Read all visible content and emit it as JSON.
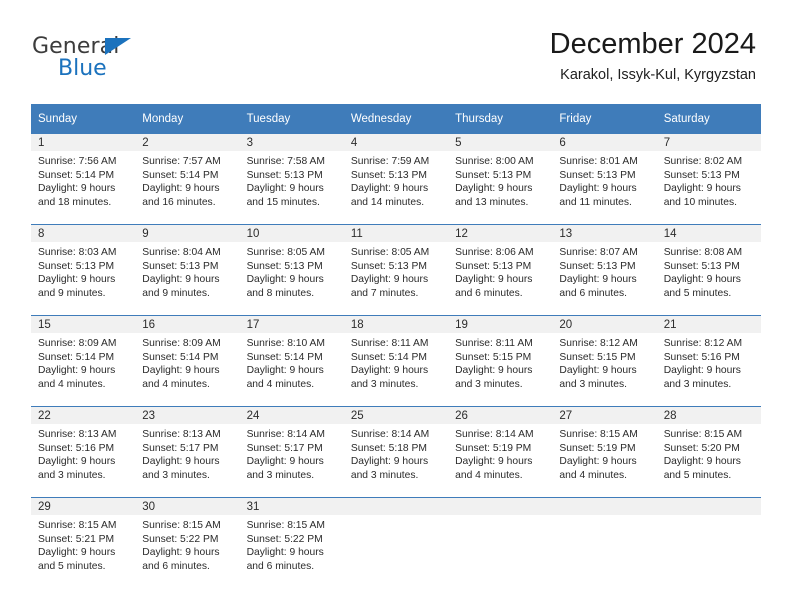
{
  "logo": {
    "text_general": "General",
    "text_blue": "Blue",
    "triangle_icon": "blue-triangle-icon",
    "color_blue": "#1b72bd",
    "color_general": "#3c3c3c"
  },
  "header": {
    "title": "December 2024",
    "subtitle": "Karakol, Issyk-Kul, Kyrgyzstan"
  },
  "theme": {
    "header_blue": "#3f7cba",
    "row_band_gray": "#f1f1f1",
    "text_dark": "#2b2b2b"
  },
  "calendar": {
    "weekday_headers": [
      "Sunday",
      "Monday",
      "Tuesday",
      "Wednesday",
      "Thursday",
      "Friday",
      "Saturday"
    ],
    "weeks": [
      [
        {
          "day": "1",
          "sunrise": "Sunrise: 7:56 AM",
          "sunset": "Sunset: 5:14 PM",
          "daylight_1": "Daylight: 9 hours",
          "daylight_2": "and 18 minutes."
        },
        {
          "day": "2",
          "sunrise": "Sunrise: 7:57 AM",
          "sunset": "Sunset: 5:14 PM",
          "daylight_1": "Daylight: 9 hours",
          "daylight_2": "and 16 minutes."
        },
        {
          "day": "3",
          "sunrise": "Sunrise: 7:58 AM",
          "sunset": "Sunset: 5:13 PM",
          "daylight_1": "Daylight: 9 hours",
          "daylight_2": "and 15 minutes."
        },
        {
          "day": "4",
          "sunrise": "Sunrise: 7:59 AM",
          "sunset": "Sunset: 5:13 PM",
          "daylight_1": "Daylight: 9 hours",
          "daylight_2": "and 14 minutes."
        },
        {
          "day": "5",
          "sunrise": "Sunrise: 8:00 AM",
          "sunset": "Sunset: 5:13 PM",
          "daylight_1": "Daylight: 9 hours",
          "daylight_2": "and 13 minutes."
        },
        {
          "day": "6",
          "sunrise": "Sunrise: 8:01 AM",
          "sunset": "Sunset: 5:13 PM",
          "daylight_1": "Daylight: 9 hours",
          "daylight_2": "and 11 minutes."
        },
        {
          "day": "7",
          "sunrise": "Sunrise: 8:02 AM",
          "sunset": "Sunset: 5:13 PM",
          "daylight_1": "Daylight: 9 hours",
          "daylight_2": "and 10 minutes."
        }
      ],
      [
        {
          "day": "8",
          "sunrise": "Sunrise: 8:03 AM",
          "sunset": "Sunset: 5:13 PM",
          "daylight_1": "Daylight: 9 hours",
          "daylight_2": "and 9 minutes."
        },
        {
          "day": "9",
          "sunrise": "Sunrise: 8:04 AM",
          "sunset": "Sunset: 5:13 PM",
          "daylight_1": "Daylight: 9 hours",
          "daylight_2": "and 9 minutes."
        },
        {
          "day": "10",
          "sunrise": "Sunrise: 8:05 AM",
          "sunset": "Sunset: 5:13 PM",
          "daylight_1": "Daylight: 9 hours",
          "daylight_2": "and 8 minutes."
        },
        {
          "day": "11",
          "sunrise": "Sunrise: 8:05 AM",
          "sunset": "Sunset: 5:13 PM",
          "daylight_1": "Daylight: 9 hours",
          "daylight_2": "and 7 minutes."
        },
        {
          "day": "12",
          "sunrise": "Sunrise: 8:06 AM",
          "sunset": "Sunset: 5:13 PM",
          "daylight_1": "Daylight: 9 hours",
          "daylight_2": "and 6 minutes."
        },
        {
          "day": "13",
          "sunrise": "Sunrise: 8:07 AM",
          "sunset": "Sunset: 5:13 PM",
          "daylight_1": "Daylight: 9 hours",
          "daylight_2": "and 6 minutes."
        },
        {
          "day": "14",
          "sunrise": "Sunrise: 8:08 AM",
          "sunset": "Sunset: 5:13 PM",
          "daylight_1": "Daylight: 9 hours",
          "daylight_2": "and 5 minutes."
        }
      ],
      [
        {
          "day": "15",
          "sunrise": "Sunrise: 8:09 AM",
          "sunset": "Sunset: 5:14 PM",
          "daylight_1": "Daylight: 9 hours",
          "daylight_2": "and 4 minutes."
        },
        {
          "day": "16",
          "sunrise": "Sunrise: 8:09 AM",
          "sunset": "Sunset: 5:14 PM",
          "daylight_1": "Daylight: 9 hours",
          "daylight_2": "and 4 minutes."
        },
        {
          "day": "17",
          "sunrise": "Sunrise: 8:10 AM",
          "sunset": "Sunset: 5:14 PM",
          "daylight_1": "Daylight: 9 hours",
          "daylight_2": "and 4 minutes."
        },
        {
          "day": "18",
          "sunrise": "Sunrise: 8:11 AM",
          "sunset": "Sunset: 5:14 PM",
          "daylight_1": "Daylight: 9 hours",
          "daylight_2": "and 3 minutes."
        },
        {
          "day": "19",
          "sunrise": "Sunrise: 8:11 AM",
          "sunset": "Sunset: 5:15 PM",
          "daylight_1": "Daylight: 9 hours",
          "daylight_2": "and 3 minutes."
        },
        {
          "day": "20",
          "sunrise": "Sunrise: 8:12 AM",
          "sunset": "Sunset: 5:15 PM",
          "daylight_1": "Daylight: 9 hours",
          "daylight_2": "and 3 minutes."
        },
        {
          "day": "21",
          "sunrise": "Sunrise: 8:12 AM",
          "sunset": "Sunset: 5:16 PM",
          "daylight_1": "Daylight: 9 hours",
          "daylight_2": "and 3 minutes."
        }
      ],
      [
        {
          "day": "22",
          "sunrise": "Sunrise: 8:13 AM",
          "sunset": "Sunset: 5:16 PM",
          "daylight_1": "Daylight: 9 hours",
          "daylight_2": "and 3 minutes."
        },
        {
          "day": "23",
          "sunrise": "Sunrise: 8:13 AM",
          "sunset": "Sunset: 5:17 PM",
          "daylight_1": "Daylight: 9 hours",
          "daylight_2": "and 3 minutes."
        },
        {
          "day": "24",
          "sunrise": "Sunrise: 8:14 AM",
          "sunset": "Sunset: 5:17 PM",
          "daylight_1": "Daylight: 9 hours",
          "daylight_2": "and 3 minutes."
        },
        {
          "day": "25",
          "sunrise": "Sunrise: 8:14 AM",
          "sunset": "Sunset: 5:18 PM",
          "daylight_1": "Daylight: 9 hours",
          "daylight_2": "and 3 minutes."
        },
        {
          "day": "26",
          "sunrise": "Sunrise: 8:14 AM",
          "sunset": "Sunset: 5:19 PM",
          "daylight_1": "Daylight: 9 hours",
          "daylight_2": "and 4 minutes."
        },
        {
          "day": "27",
          "sunrise": "Sunrise: 8:15 AM",
          "sunset": "Sunset: 5:19 PM",
          "daylight_1": "Daylight: 9 hours",
          "daylight_2": "and 4 minutes."
        },
        {
          "day": "28",
          "sunrise": "Sunrise: 8:15 AM",
          "sunset": "Sunset: 5:20 PM",
          "daylight_1": "Daylight: 9 hours",
          "daylight_2": "and 5 minutes."
        }
      ],
      [
        {
          "day": "29",
          "sunrise": "Sunrise: 8:15 AM",
          "sunset": "Sunset: 5:21 PM",
          "daylight_1": "Daylight: 9 hours",
          "daylight_2": "and 5 minutes."
        },
        {
          "day": "30",
          "sunrise": "Sunrise: 8:15 AM",
          "sunset": "Sunset: 5:22 PM",
          "daylight_1": "Daylight: 9 hours",
          "daylight_2": "and 6 minutes."
        },
        {
          "day": "31",
          "sunrise": "Sunrise: 8:15 AM",
          "sunset": "Sunset: 5:22 PM",
          "daylight_1": "Daylight: 9 hours",
          "daylight_2": "and 6 minutes."
        },
        {
          "day": "",
          "sunrise": "",
          "sunset": "",
          "daylight_1": "",
          "daylight_2": ""
        },
        {
          "day": "",
          "sunrise": "",
          "sunset": "",
          "daylight_1": "",
          "daylight_2": ""
        },
        {
          "day": "",
          "sunrise": "",
          "sunset": "",
          "daylight_1": "",
          "daylight_2": ""
        },
        {
          "day": "",
          "sunrise": "",
          "sunset": "",
          "daylight_1": "",
          "daylight_2": ""
        }
      ]
    ]
  }
}
